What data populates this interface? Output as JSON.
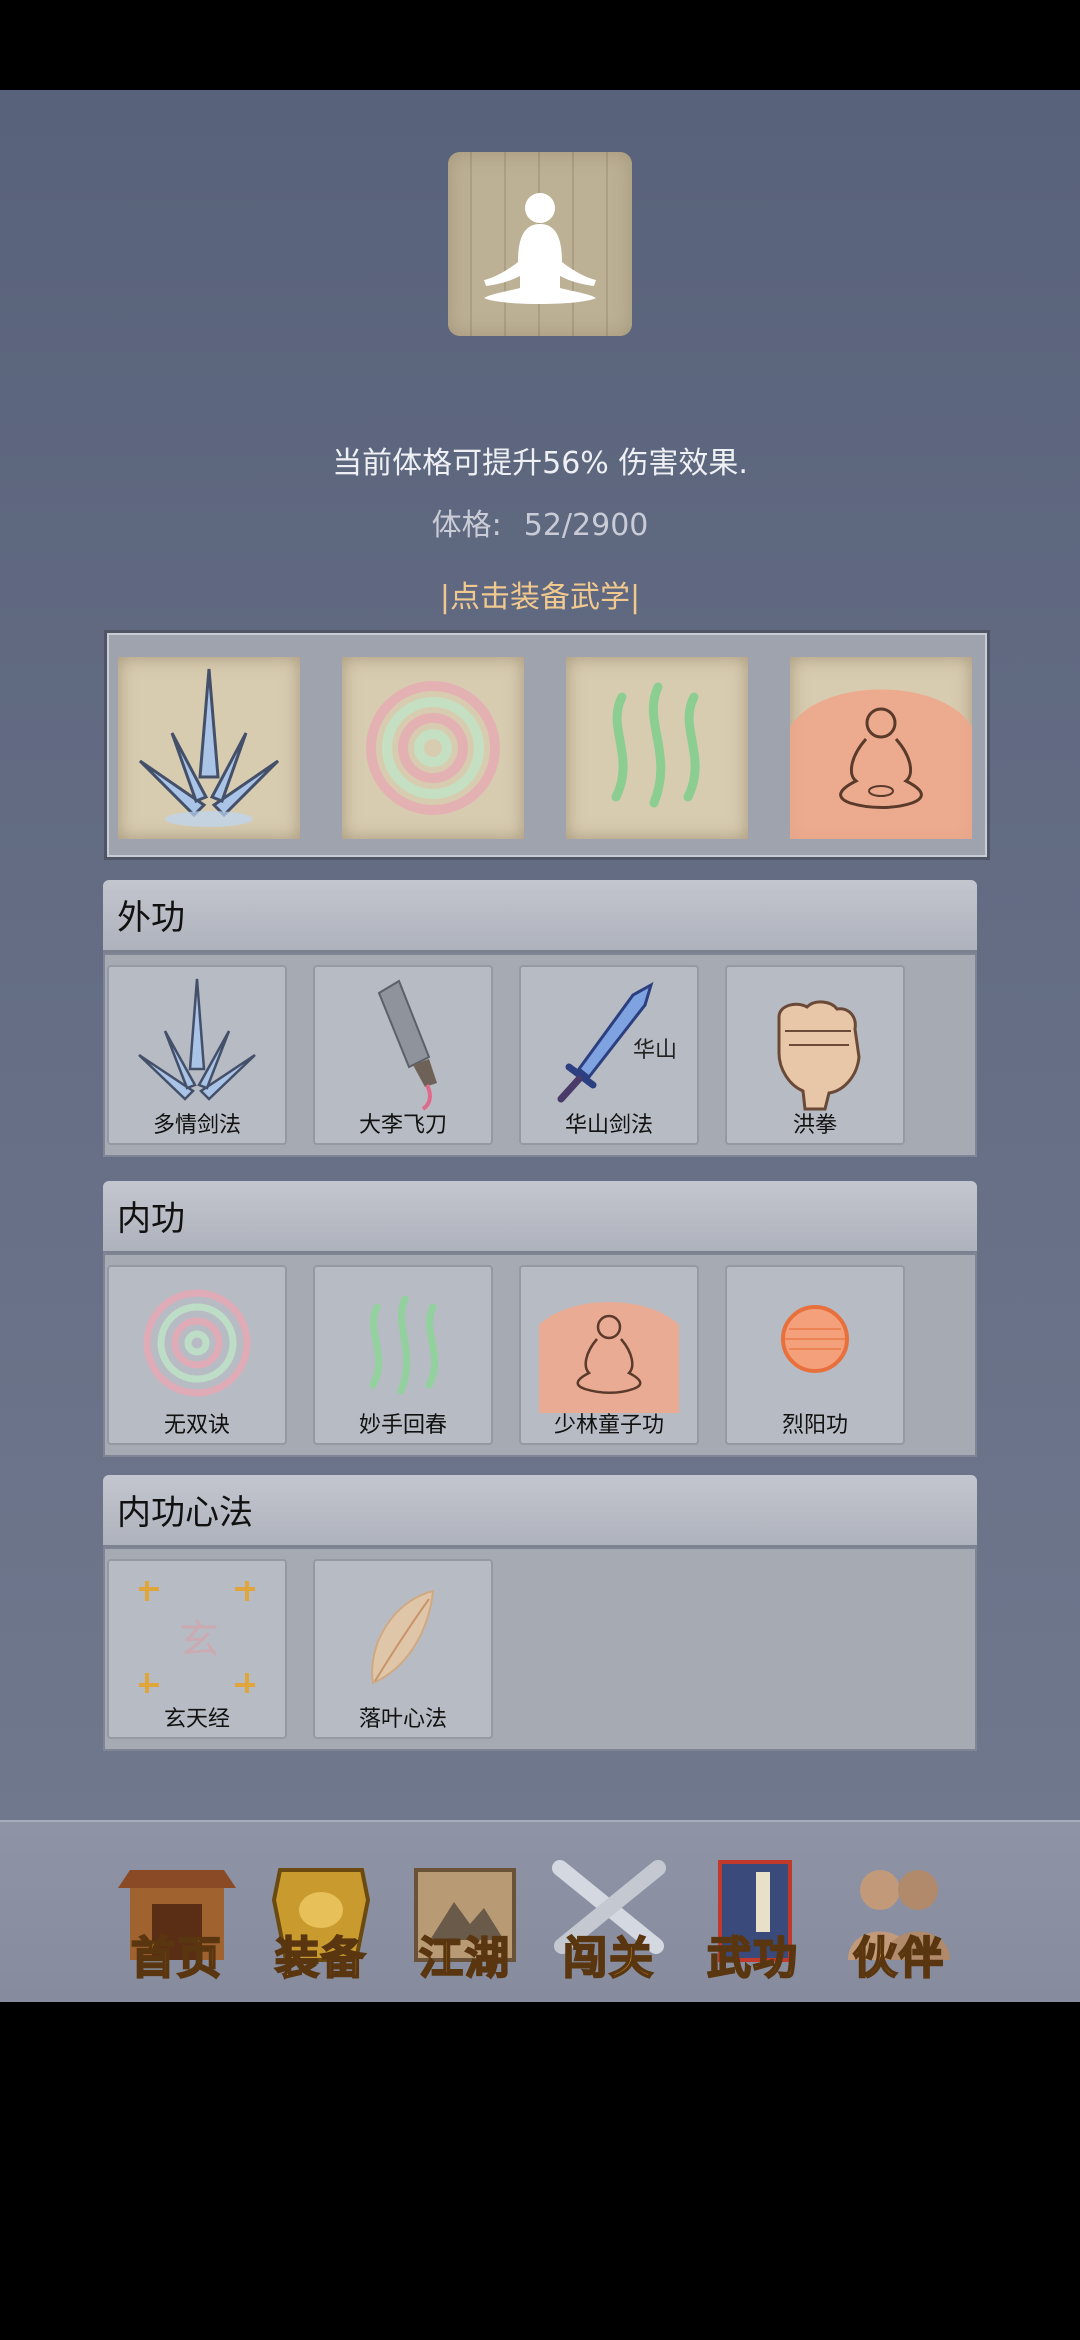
{
  "profile": {
    "icon": "meditation-figure-icon",
    "bonus_text": "当前体格可提升56% 伤害效果.",
    "stat_label": "体格:",
    "stat_value": "52/2900",
    "equip_hint": "|点击装备武学|"
  },
  "equipped": [
    {
      "icon": "crystal-blades-icon"
    },
    {
      "icon": "spiral-icon"
    },
    {
      "icon": "green-waves-icon"
    },
    {
      "icon": "buddha-aura-icon"
    }
  ],
  "sections": {
    "external": {
      "title": "外功",
      "skills": [
        {
          "label": "多情剑法",
          "icon": "crystal-blades-icon"
        },
        {
          "label": "大李飞刀",
          "icon": "cleaver-icon"
        },
        {
          "label": "华山剑法",
          "icon": "huashan-sword-icon",
          "icon_text": "华山"
        },
        {
          "label": "洪拳",
          "icon": "fist-icon"
        }
      ]
    },
    "internal": {
      "title": "内功",
      "skills": [
        {
          "label": "无双诀",
          "icon": "spiral-icon"
        },
        {
          "label": "妙手回春",
          "icon": "green-waves-icon"
        },
        {
          "label": "少林童子功",
          "icon": "buddha-aura-icon"
        },
        {
          "label": "烈阳功",
          "icon": "sun-orb-icon"
        }
      ]
    },
    "mind": {
      "title": "内功心法",
      "skills": [
        {
          "label": "玄天经",
          "icon": "xuan-seal-icon",
          "icon_text": "玄"
        },
        {
          "label": "落叶心法",
          "icon": "leaf-icon"
        }
      ]
    }
  },
  "nav": [
    {
      "label": "首页",
      "icon": "temple-icon"
    },
    {
      "label": "装备",
      "icon": "armor-icon"
    },
    {
      "label": "江湖",
      "icon": "scroll-map-icon"
    },
    {
      "label": "闯关",
      "icon": "crossed-swords-icon"
    },
    {
      "label": "武功",
      "icon": "manual-book-icon"
    },
    {
      "label": "伙伴",
      "icon": "companions-icon"
    }
  ],
  "colors": {
    "hint": "#f1c98f",
    "nav_label": "#f6b52c",
    "nav_active_frame": "#c0392b"
  }
}
